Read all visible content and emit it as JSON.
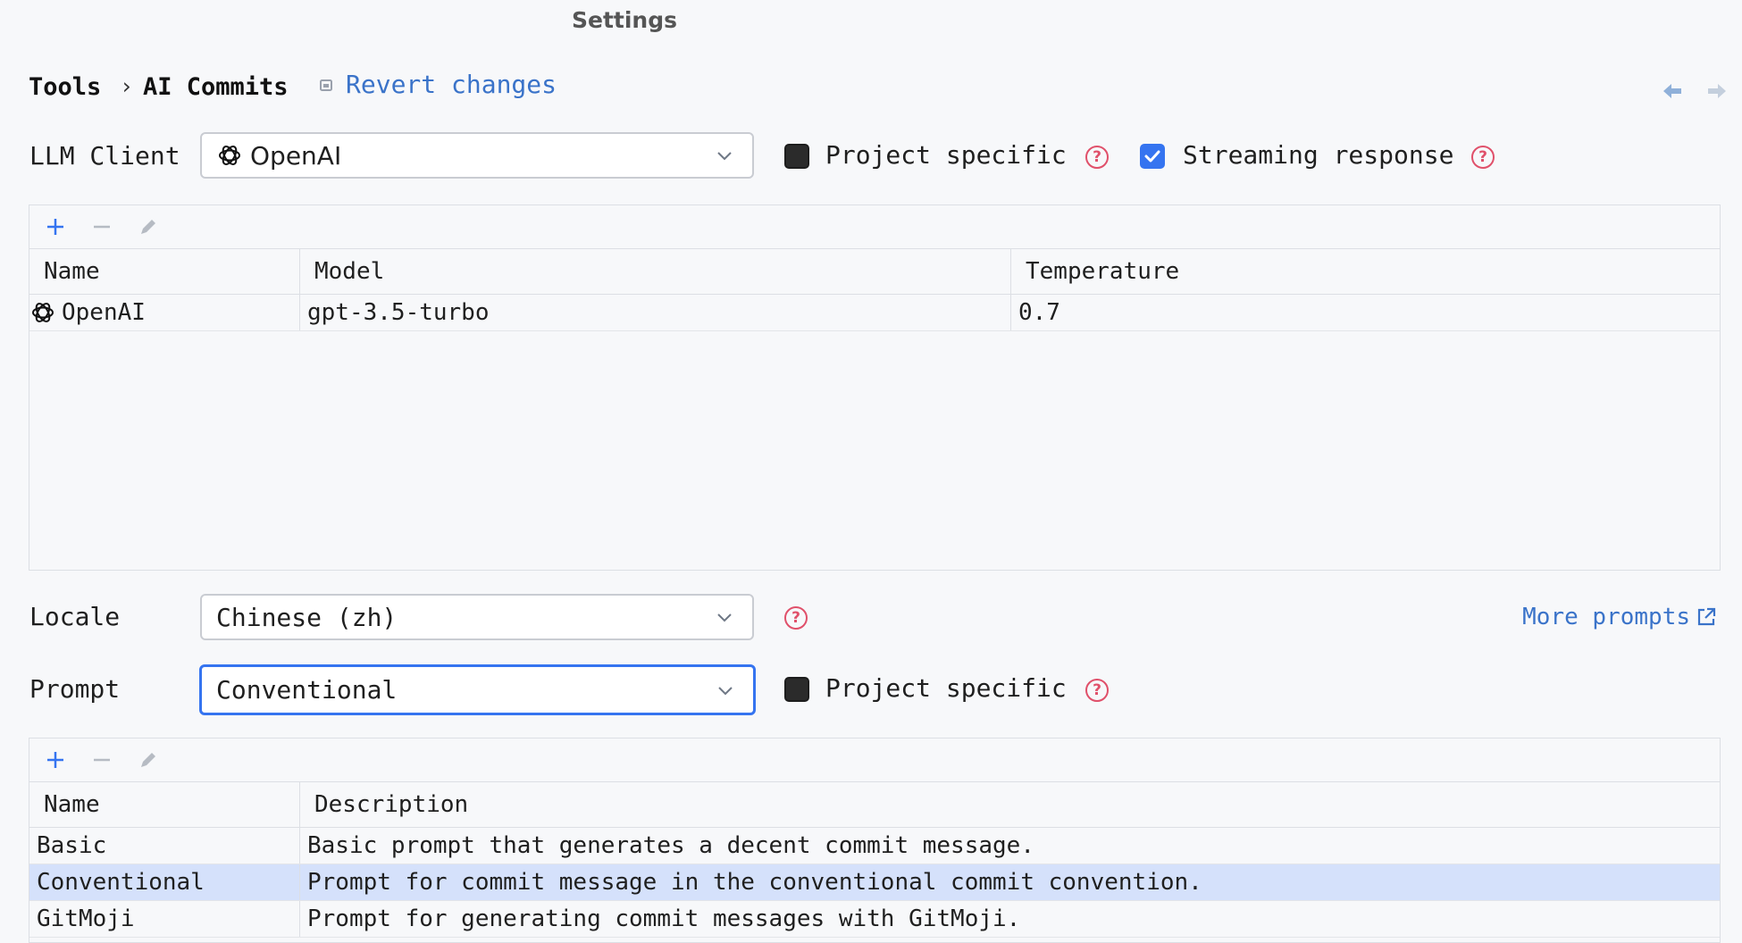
{
  "window": {
    "title": "Settings"
  },
  "breadcrumb": {
    "parent": "Tools",
    "separator": "›",
    "current": "AI Commits"
  },
  "header": {
    "revert_label": "Revert changes",
    "back_icon": "arrow-left-icon",
    "forward_icon": "arrow-right-icon"
  },
  "llm": {
    "label": "LLM Client",
    "selected": "OpenAI",
    "project_specific": {
      "label": "Project specific",
      "checked": false
    },
    "streaming": {
      "label": "Streaming response",
      "checked": true
    }
  },
  "clients_table": {
    "columns": [
      "Name",
      "Model",
      "Temperature"
    ],
    "rows": [
      {
        "name": "OpenAI",
        "model": "gpt-3.5-turbo",
        "temperature": "0.7"
      }
    ]
  },
  "locale": {
    "label": "Locale",
    "selected": "Chinese (zh)"
  },
  "more_prompts": {
    "label": "More prompts"
  },
  "prompt": {
    "label": "Prompt",
    "selected": "Conventional",
    "project_specific": {
      "label": "Project specific",
      "checked": false
    }
  },
  "prompts_table": {
    "columns": [
      "Name",
      "Description"
    ],
    "rows": [
      {
        "name": "Basic",
        "description": "Basic prompt that generates a decent commit message."
      },
      {
        "name": "Conventional",
        "description": "Prompt for commit message in the conventional commit convention.",
        "selected": true
      },
      {
        "name": "GitMoji",
        "description": "Prompt for generating commit messages with GitMoji."
      }
    ]
  },
  "colors": {
    "accent": "#3574f0",
    "link": "#3a73c9",
    "help": "#e0506a",
    "selection": "#d5e1fb"
  }
}
